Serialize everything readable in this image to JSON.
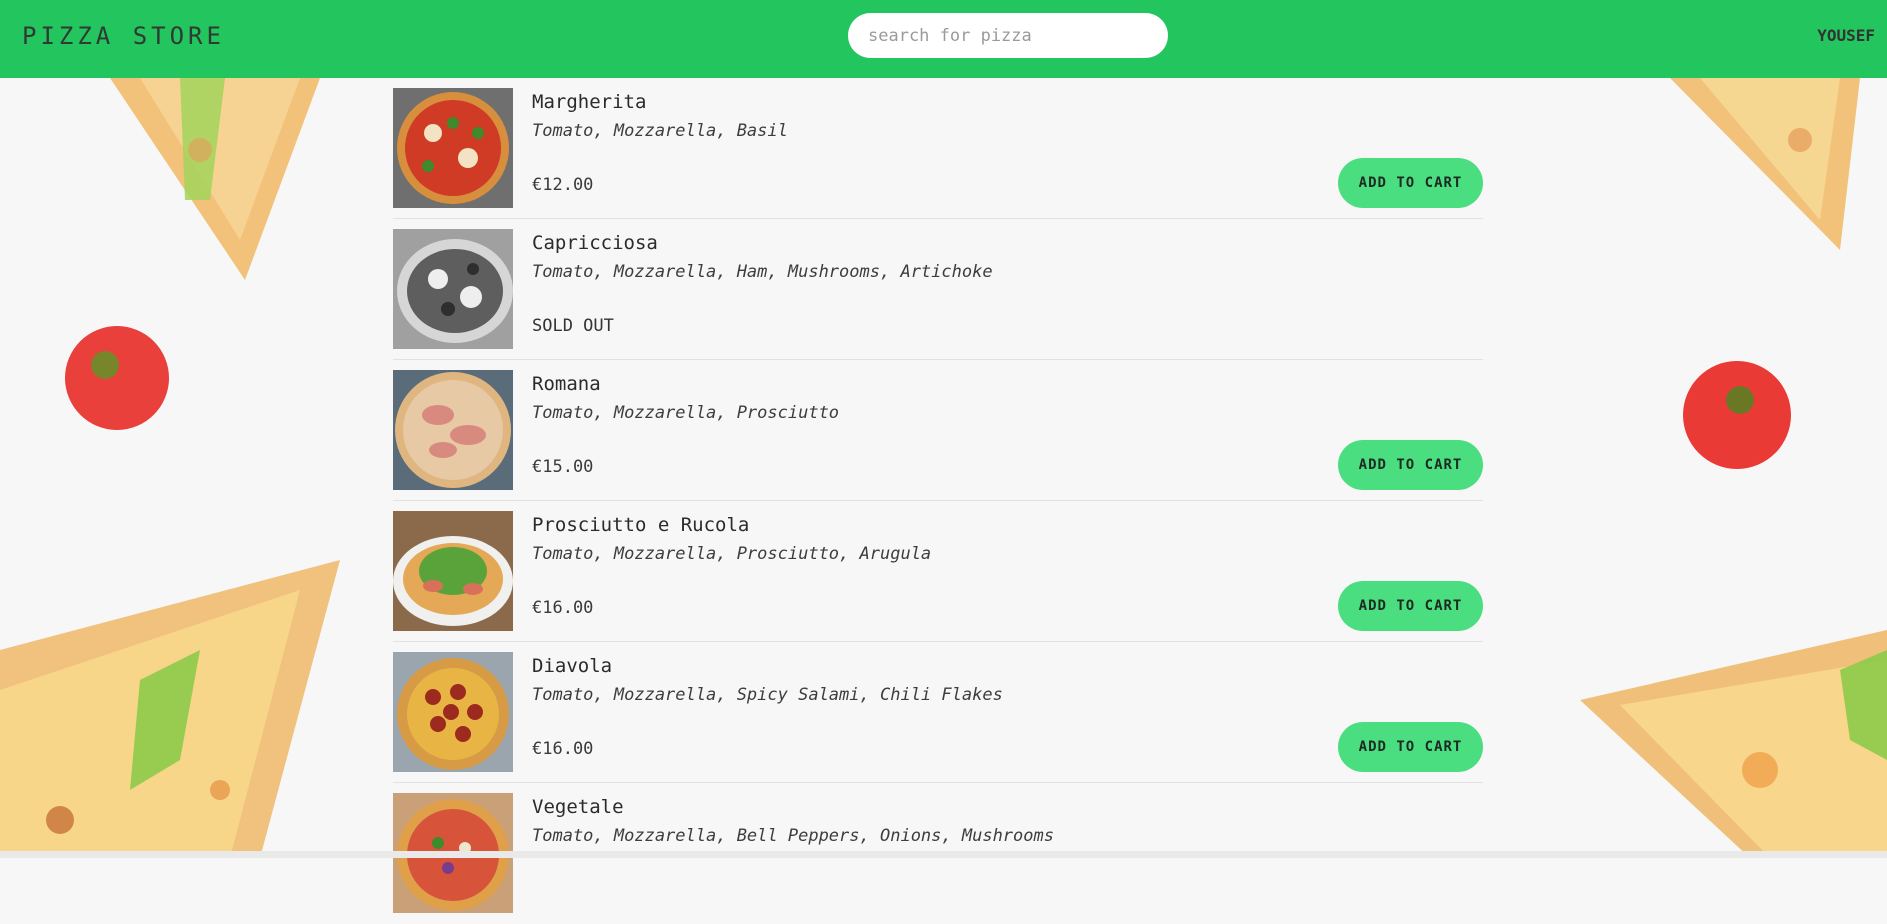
{
  "header": {
    "brand": "PIZZA STORE",
    "search_placeholder": "search for pizza",
    "search_value": "",
    "user": "YOUSEF"
  },
  "colors": {
    "header_bg": "#22c55e",
    "button_bg": "#4ade80"
  },
  "menu": {
    "items": [
      {
        "name": "Margherita",
        "ingredients": "Tomato, Mozzarella, Basil",
        "price": "€12.00",
        "cart_label": "ADD TO CART",
        "sold_out": false
      },
      {
        "name": "Capricciosa",
        "ingredients": "Tomato, Mozzarella, Ham, Mushrooms, Artichoke",
        "status": "SOLD OUT",
        "sold_out": true
      },
      {
        "name": "Romana",
        "ingredients": "Tomato, Mozzarella, Prosciutto",
        "price": "€15.00",
        "cart_label": "ADD TO CART",
        "sold_out": false
      },
      {
        "name": "Prosciutto e Rucola",
        "ingredients": "Tomato, Mozzarella, Prosciutto, Arugula",
        "price": "€16.00",
        "cart_label": "ADD TO CART",
        "sold_out": false
      },
      {
        "name": "Diavola",
        "ingredients": "Tomato, Mozzarella, Spicy Salami, Chili Flakes",
        "price": "€16.00",
        "cart_label": "ADD TO CART",
        "sold_out": false
      },
      {
        "name": "Vegetale",
        "ingredients": "Tomato, Mozzarella, Bell Peppers, Onions, Mushrooms"
      }
    ]
  }
}
